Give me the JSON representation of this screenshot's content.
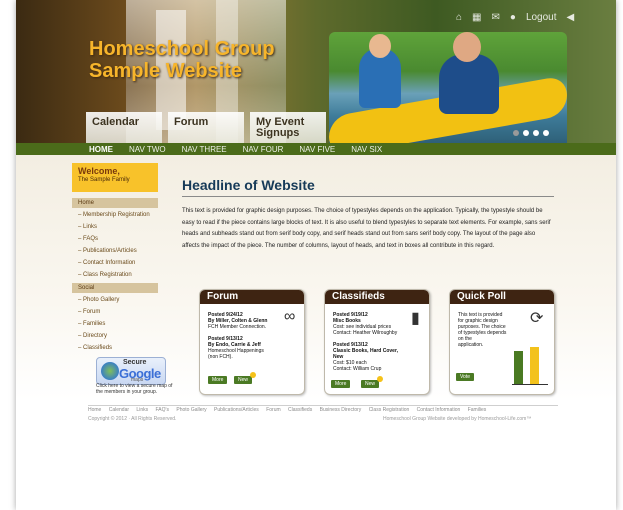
{
  "site": {
    "title_line1": "Homeschool Group",
    "title_line2": "Sample Website",
    "top_icon_label": "Logout"
  },
  "tiles": [
    {
      "label": "Calendar"
    },
    {
      "label": "Forum"
    },
    {
      "label_line1": "My Event",
      "label_line2": "Signups"
    }
  ],
  "nav": [
    "HOME",
    "NAV TWO",
    "NAV THREE",
    "NAV FOUR",
    "NAV FIVE",
    "NAV SIX"
  ],
  "welcome": {
    "title": "Welcome,",
    "subtitle": "The Sample Family"
  },
  "sidebar": {
    "home_header": "Home",
    "home_items": [
      "Membership Registration",
      "Links",
      "FAQs",
      "Publications/Articles",
      "Contact Information",
      "Class Registration"
    ],
    "social_header": "Social",
    "social_items": [
      "Photo Gallery",
      "Forum",
      "Families",
      "Directory",
      "Classifieds"
    ]
  },
  "gmaps": {
    "secure": "Secure",
    "google": "Google",
    "maps": "maps",
    "caption": "Click here to view a secure map of the members in your group."
  },
  "main": {
    "headline": "Headline of Website",
    "body": "This text is provided for graphic design purposes. The choice of typestyles depends on the application. Typically, the typestyle should be easy to read if the piece contains large blocks of text. It is also useful to blend typestyles to separate text elements. For example, sans serif heads and subheads stand out from serif body copy, and serif heads stand out from sans serif body copy. The layout of the page also affects the impact of the piece. The number of columns, layout of heads, and text in boxes all contribute in this regard."
  },
  "forum": {
    "title": "Forum",
    "p1_date": "Posted 9/24/12",
    "p1_by": "By Miller, Colten & Glenn",
    "p1_line": "FCH Member Connection.",
    "p2_date": "Posted 9/13/12",
    "p2_by": "By Endo, Carrie & Jeff",
    "p2_line1": "Homeschool Happenings",
    "p2_line2": "(non FCH).",
    "more": "More",
    "new": "New"
  },
  "classifieds": {
    "title": "Classifieds",
    "p1_date": "Posted 9/19/12",
    "p1_title": "Misc Books",
    "p1_cost": "Cost: see individual prices",
    "p1_contact": "Contact: Heather Wilroughby",
    "p2_date": "Posted 9/13/12",
    "p2_title": "Classic Books, Hard Cover, New",
    "p2_cost": "Cost: $10 each",
    "p2_contact": "Contact: William Crup",
    "more": "More",
    "new": "New"
  },
  "poll": {
    "title": "Quick Poll",
    "line1": "This text is provided",
    "line2": "for graphic design",
    "line3": "purposes. The choice",
    "line4": "of typestyles depends",
    "line5": "on the",
    "line6": "application.",
    "vote": "Vote"
  },
  "footer": {
    "links": [
      "Home",
      "Calendar",
      "Links",
      "FAQ's",
      "Photo Gallery",
      "Publications/Articles",
      "Forum",
      "Classifieds",
      "Business Directory",
      "Class Registration",
      "Contact Information",
      "Families"
    ],
    "copyright": "Copyright © 2012  ·  All Rights Reserved.",
    "credit": "Homeschool Group Website developed by Homeschool-Life.com™"
  },
  "colors": {
    "nav_bg": "#4b6b1a",
    "headline": "#163a58",
    "welcome_bg": "#f8c22a",
    "box_header": "#3e2412",
    "button": "#4b7a24"
  }
}
